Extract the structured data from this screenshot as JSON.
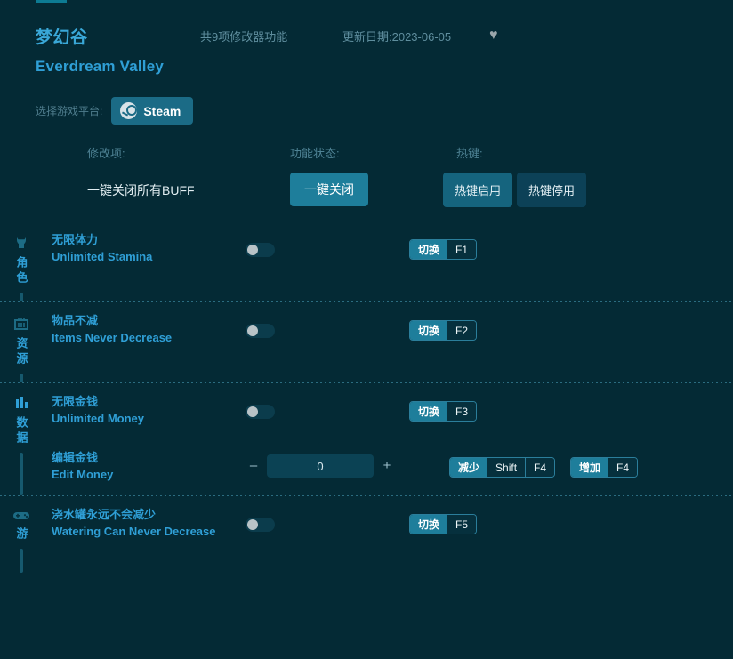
{
  "header": {
    "title_cn": "梦幻谷",
    "title_en": "Everdream Valley",
    "feature_count": "共9项修改器功能",
    "update_date": "更新日期:2023-06-05",
    "favorite_icon": "♥",
    "accent_color": "#2f9fd6"
  },
  "platform": {
    "label": "选择游戏平台:",
    "selected": "Steam"
  },
  "columns": {
    "option": "修改项:",
    "status": "功能状态:",
    "hotkey": "热键:"
  },
  "onekey": {
    "label": "一键关闭所有BUFF",
    "button": "一键关闭",
    "hotkey_on": "热键启用",
    "hotkey_off": "热键停用"
  },
  "sections": [
    {
      "icon": "character-icon",
      "name": "角色",
      "rows": [
        {
          "name_cn": "无限体力",
          "name_en": "Unlimited Stamina",
          "control": "toggle",
          "toggle_on": false,
          "chip": {
            "action": "切换",
            "keys": [
              "F1"
            ]
          }
        }
      ]
    },
    {
      "icon": "basket-icon",
      "name": "资源",
      "rows": [
        {
          "name_cn": "物品不减",
          "name_en": "Items Never Decrease",
          "control": "toggle",
          "toggle_on": false,
          "chip": {
            "action": "切换",
            "keys": [
              "F2"
            ]
          }
        }
      ]
    },
    {
      "icon": "chart-icon",
      "name": "数据",
      "rows": [
        {
          "name_cn": "无限金钱",
          "name_en": "Unlimited Money",
          "control": "toggle",
          "toggle_on": false,
          "chip": {
            "action": "切换",
            "keys": [
              "F3"
            ]
          }
        },
        {
          "name_cn": "编辑金钱",
          "name_en": "Edit Money",
          "control": "stepper",
          "value": "0",
          "minus": "–",
          "plus": "+",
          "chip_dec": {
            "action": "减少",
            "keys": [
              "Shift",
              "F4"
            ]
          },
          "chip_inc": {
            "action": "增加",
            "keys": [
              "F4"
            ]
          }
        }
      ]
    },
    {
      "icon": "gamepad-icon",
      "name": "游",
      "rows": [
        {
          "name_cn": "浇水罐永远不会减少",
          "name_en": "Watering Can Never Decrease",
          "control": "toggle",
          "toggle_on": false,
          "chip": {
            "action": "切换",
            "keys": [
              "F5"
            ]
          }
        }
      ]
    }
  ]
}
